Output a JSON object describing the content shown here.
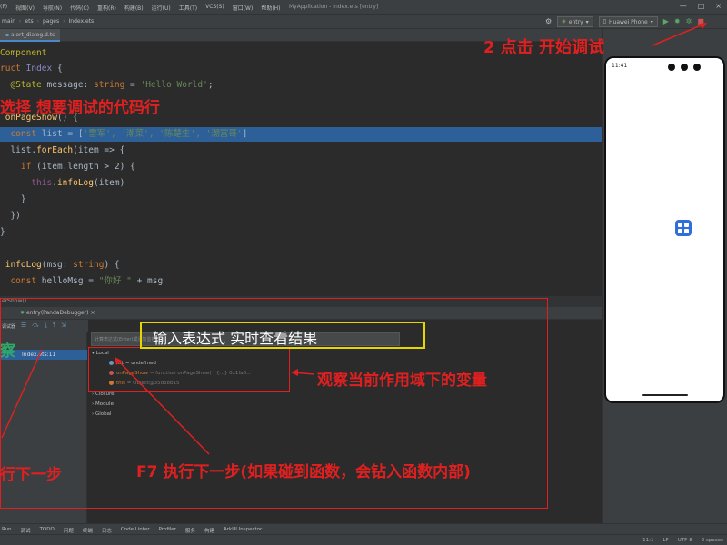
{
  "menubar": {
    "items": [
      "(F)",
      "视图(V)",
      "导航(N)",
      "代码(C)",
      "重构(R)",
      "构建(B)",
      "运行(U)",
      "工具(T)",
      "VCS(S)",
      "窗口(W)",
      "帮助(H)"
    ],
    "window_title": "MyApplication - Index.ets [entry]",
    "controls": [
      "—",
      "□",
      "×"
    ]
  },
  "navbar": {
    "crumbs": [
      "main",
      "ets",
      "pages",
      "Index.ets"
    ],
    "module": "entry",
    "device": "Huawei Phone"
  },
  "editor_tab": "alert_dialog.d.ts",
  "code": {
    "l1": "Component",
    "l2_kw": "ruct",
    "l2_name": "Index",
    "l2_brace": " {",
    "l3_ann": "@State",
    "l3_rest": " message: ",
    "l3_type": "string",
    "l3_eq": " = ",
    "l3_str": "'Hello World'",
    "l3_end": ";",
    "l5_fn": "onPageShow",
    "l5_rest": "() {",
    "l6_kw": "const",
    "l6_rest": " list = [",
    "l6_arr": "'雷军', '潮菜', '陈楚生', '潮富哥'",
    "l6_end": "]",
    "l7_a": "list.",
    "l7_fn": "forEach",
    "l7_b": "(item => {",
    "l8_kw": "if",
    "l8_rest": " (item.length > 2) {",
    "l9_this": "this",
    "l9_dot": ".",
    "l9_fn": "infoLog",
    "l9_rest": "(item)",
    "l10": "}",
    "l11": "})",
    "l12": "}",
    "l14_fn": "infoLog",
    "l14_rest": "(msg: ",
    "l14_type": "string",
    "l14_end": ") {",
    "l15_kw": "const",
    "l15_rest": " helloMsg = ",
    "l15_str": "\"你好 \"",
    "l15_end": " + msg"
  },
  "editor_status": "erShow()",
  "debugger": {
    "tab_label": "entry(PandaDebugger)",
    "tools_label": "调试器",
    "frame_label": "Index.ets:11",
    "eval_placeholder": "计算表达式(Enter)或添加监视",
    "scope_local": "Local",
    "var_list": "list = undefined",
    "var_onpageshow_name": "onPageShow",
    "var_onpageshow_val": " = function onPageShow( ) {...} 0x1fa6...",
    "var_this_name": "this",
    "var_this_val": " = Object@35d38b15",
    "scope_closure": "Closure",
    "scope_module": "Module",
    "scope_global": "Global"
  },
  "bottom_tools": [
    "Run",
    "调试",
    "TODO",
    "问题",
    "终端",
    "日志",
    "Code Linter",
    "Profiler",
    "服务",
    "构建",
    "ArkUI Inspector"
  ],
  "statusbar": {
    "right": [
      "11:1",
      "LF",
      "UTF-8",
      "2 spaces"
    ]
  },
  "phone": {
    "time": "11:41"
  },
  "annotations": {
    "step2": "2 点击 开始调试",
    "step1": "选择 想要调试的代码行",
    "eval": "输入表达式 实时查看结果",
    "observe": "观察当前作用域下的变量",
    "f7": "F7 执行下一步(如果碰到函数，会钻入函数内部)",
    "left_step": "行下一步",
    "left_word": "察"
  }
}
